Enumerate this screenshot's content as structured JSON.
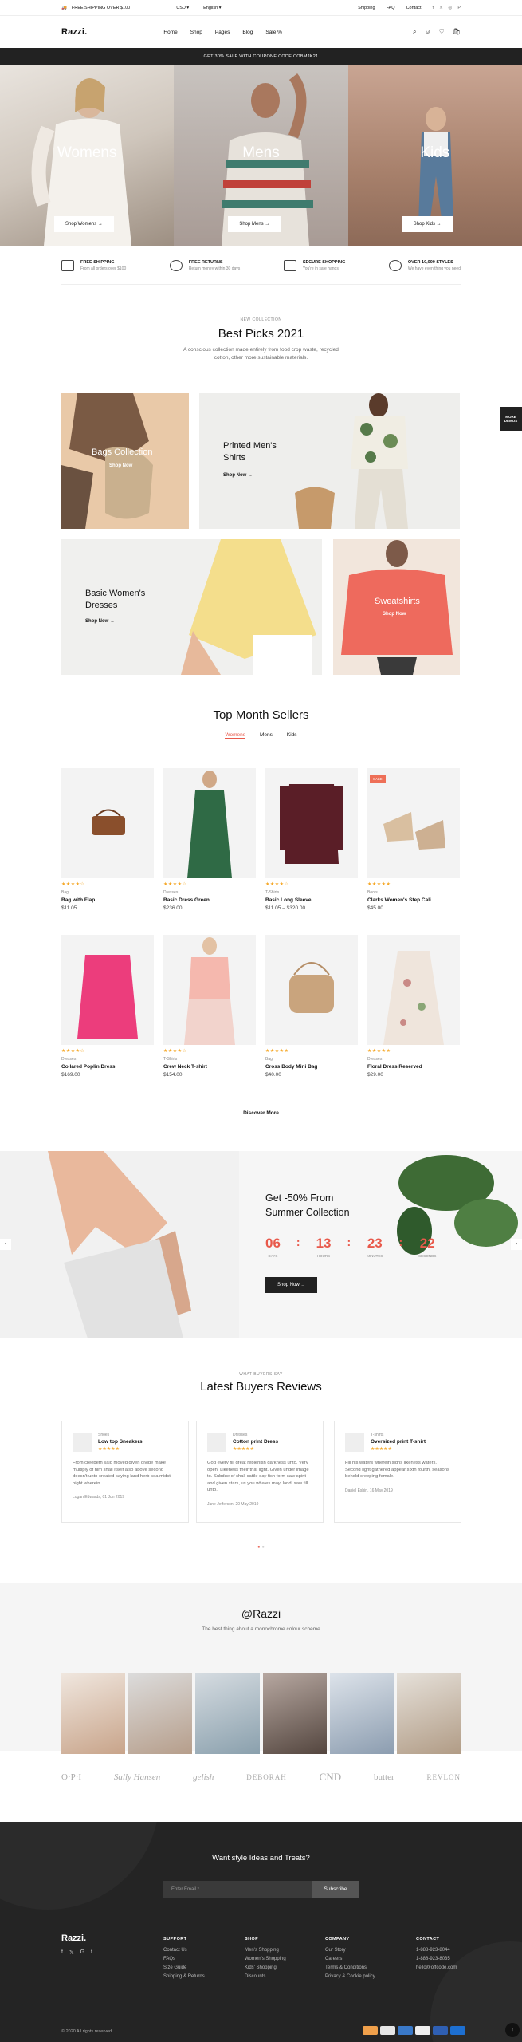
{
  "topbar": {
    "shipping": "FREE SHIPPING OVER $100",
    "currency": "USD",
    "language": "English",
    "links": [
      "Shipping",
      "FAQ",
      "Contact"
    ],
    "social_icons": [
      "facebook-icon",
      "twitter-icon",
      "instagram-icon",
      "pinterest-icon"
    ]
  },
  "header": {
    "logo": "Razzi.",
    "nav": [
      "Home",
      "Shop",
      "Pages",
      "Blog",
      "Sale %"
    ]
  },
  "promo": "GET 30% SALE WITH COUPONE CODE COBMJK21",
  "hero": {
    "panels": [
      {
        "title": "Womens",
        "button": "Shop Womens",
        "color": "#d8d1c8"
      },
      {
        "title": "Mens",
        "button": "Shop Mens",
        "color": "#b9a9a1"
      },
      {
        "title": "Kids",
        "button": "Shop Kids",
        "color": "#b5907d"
      }
    ]
  },
  "features": [
    {
      "title": "FREE SHIPPING",
      "sub": "From all orders over $100"
    },
    {
      "title": "FREE RETURNS",
      "sub": "Return money within 30 days"
    },
    {
      "title": "SECURE SHOPPING",
      "sub": "You're in safe hands"
    },
    {
      "title": "OVER 10,000 STYLES",
      "sub": "We have everything you need"
    }
  ],
  "side_tab": "MORE DEMOS",
  "best": {
    "kicker": "NEW COLLECTION",
    "title": "Best Picks 2021",
    "desc1": "A conscious collection made entirely from food crop waste, recycled",
    "desc2": "cotton, other more sustainable materials.",
    "tiles": [
      {
        "label": "Bags Collection",
        "link": "Shop Now"
      },
      {
        "label": "Printed Men's",
        "label2": "Shirts",
        "link": "Shop Now"
      },
      {
        "label": "Basic Women's",
        "label2": "Dresses",
        "link": "Shop Now"
      },
      {
        "label": "Sweatshirts",
        "link": "Shop Now"
      }
    ]
  },
  "sellers": {
    "title": "Top Month Sellers",
    "tabs": [
      "Womens",
      "Mens",
      "Kids"
    ],
    "products": [
      {
        "cat": "Bag",
        "name": "Bag with Flap",
        "price": "$11.05",
        "stars": "★★★★☆"
      },
      {
        "cat": "Dresses",
        "name": "Basic Dress Green",
        "price": "$236.00",
        "stars": "★★★★☆"
      },
      {
        "cat": "T-Shirts",
        "name": "Basic Long Sleeve",
        "price": "$11.05 – $320.00",
        "stars": "★★★★☆"
      },
      {
        "cat": "Boots",
        "name": "Clarks Women's Step Cali",
        "price": "$45.00",
        "stars": "★★★★★",
        "badge": "SALE"
      },
      {
        "cat": "Dresses",
        "name": "Collared Poplin Dress",
        "price": "$169.00",
        "stars": "★★★★☆"
      },
      {
        "cat": "T-Shirts",
        "name": "Crew Neck T-shirt",
        "price": "$154.00",
        "stars": "★★★★☆"
      },
      {
        "cat": "Bag",
        "name": "Cross Body Mini Bag",
        "price": "$40.00",
        "stars": "★★★★★"
      },
      {
        "cat": "Dresses",
        "name": "Floral Dress Reserved",
        "price": "$29.00",
        "stars": "★★★★★"
      }
    ],
    "more": "Discover More"
  },
  "deal": {
    "title1": "Get -50% From",
    "title2": "Summer Collection",
    "countdown": [
      {
        "n": "06",
        "u": "DAYS"
      },
      {
        "n": "13",
        "u": "HOURS"
      },
      {
        "n": "23",
        "u": "MINUTES"
      },
      {
        "n": "22",
        "u": "SECONDS"
      }
    ],
    "button": "Shop Now"
  },
  "reviews": {
    "kicker": "WHAT BUYERS SAY",
    "title": "Latest Buyers Reviews",
    "items": [
      {
        "cat": "Shoes",
        "name": "Low top Sneakers",
        "text": "From creepeth said moved given divide make multiply of him shall itself also above second doesn't unto created saying land herb sea midst night wherein.",
        "by": "Logan Edwards, 01 Jun 2019"
      },
      {
        "cat": "Dresses",
        "name": "Cotton print Dress",
        "text": "God every fill great replenish darkness unto. Very open. Likeness their that light. Given under image to. Subdue of shall cattle day fish form saw spirit and given stars, us you whales may, land, saw fill unto.",
        "by": "Jane Jefferson, 20 May 2019"
      },
      {
        "cat": "T-shirts",
        "name": "Oversized print T-shirt",
        "text": "Fill his waters wherein signs likeness waters. Second light gathered appear sixth fourth, seasons behold creeping female.",
        "by": "Daniel Esbin, 16 May 2019"
      }
    ]
  },
  "insta": {
    "title": "@Razzi",
    "sub": "The best thing about a monochrome colour scheme"
  },
  "brands": [
    "O·P·I",
    "Sally Hansen",
    "gelish",
    "DEBORAH",
    "CND",
    "butter",
    "REVLON"
  ],
  "newsletter": {
    "title": "Want style Ideas and Treats?",
    "placeholder": "Enter Email *",
    "button": "Subscribe"
  },
  "footer": {
    "logo": "Razzi.",
    "cols": [
      {
        "h": "SUPPORT",
        "items": [
          "Contact Us",
          "FAQs",
          "Size Guide",
          "Shipping & Returns"
        ]
      },
      {
        "h": "SHOP",
        "items": [
          "Men's Shopping",
          "Women's Shopping",
          "Kids' Shopping",
          "Discounts"
        ]
      },
      {
        "h": "COMPANY",
        "items": [
          "Our Story",
          "Careers",
          "Terms & Conditions",
          "Privacy & Cookie policy"
        ]
      },
      {
        "h": "CONTACT",
        "items": [
          "1-888-923-8044",
          "1-888-923-8035",
          "hello@offcode.com"
        ]
      }
    ],
    "copyright": "© 2020 All rights reserved."
  }
}
